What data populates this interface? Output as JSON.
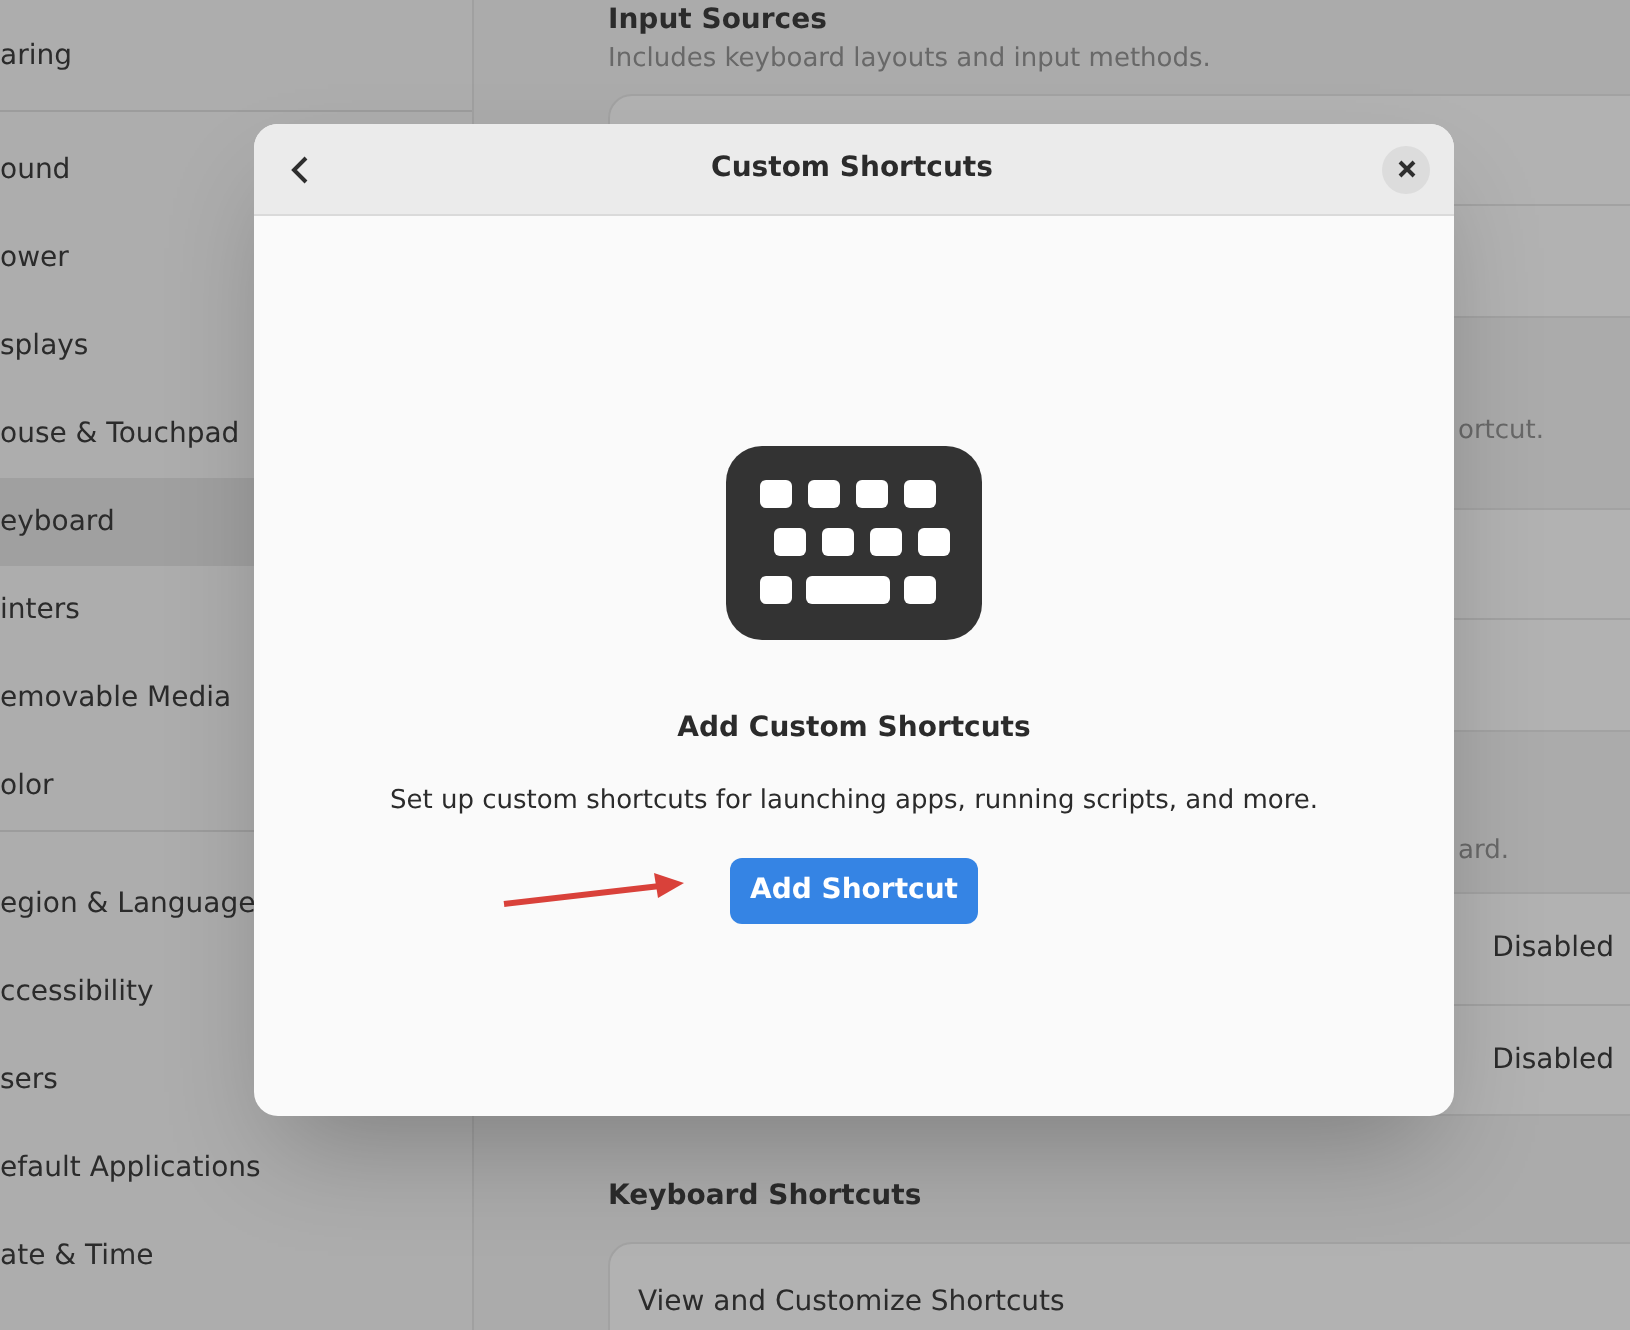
{
  "sidebar": {
    "groups": [
      {
        "items": [
          {
            "label": "aring",
            "selected": false
          }
        ]
      },
      {
        "items": [
          {
            "label": "ound",
            "selected": false
          },
          {
            "label": "ower",
            "selected": false
          },
          {
            "label": "splays",
            "selected": false
          },
          {
            "label": "ouse & Touchpad",
            "selected": false
          },
          {
            "label": "eyboard",
            "selected": true
          },
          {
            "label": "inters",
            "selected": false
          },
          {
            "label": "emovable Media",
            "selected": false
          },
          {
            "label": "olor",
            "selected": false
          }
        ]
      },
      {
        "items": [
          {
            "label": "egion & Language",
            "selected": false
          },
          {
            "label": "ccessibility",
            "selected": false
          },
          {
            "label": "sers",
            "selected": false
          },
          {
            "label": "efault Applications",
            "selected": false
          },
          {
            "label": "ate & Time",
            "selected": false
          }
        ]
      }
    ]
  },
  "input_sources": {
    "heading": "Input Sources",
    "description": "Includes keyboard layouts and input methods."
  },
  "special_character_entry": {
    "description": "ortcut."
  },
  "typing": {
    "description": "ard.",
    "rows": [
      {
        "value": "Disabled"
      },
      {
        "value": "Disabled"
      }
    ]
  },
  "keyboard_shortcuts": {
    "heading": "Keyboard Shortcuts",
    "row": "View and Customize Shortcuts"
  },
  "dialog": {
    "title": "Custom Shortcuts",
    "empty_title": "Add Custom Shortcuts",
    "empty_description": "Set up custom shortcuts for launching apps, running scripts, and more.",
    "button": "Add Shortcut"
  }
}
